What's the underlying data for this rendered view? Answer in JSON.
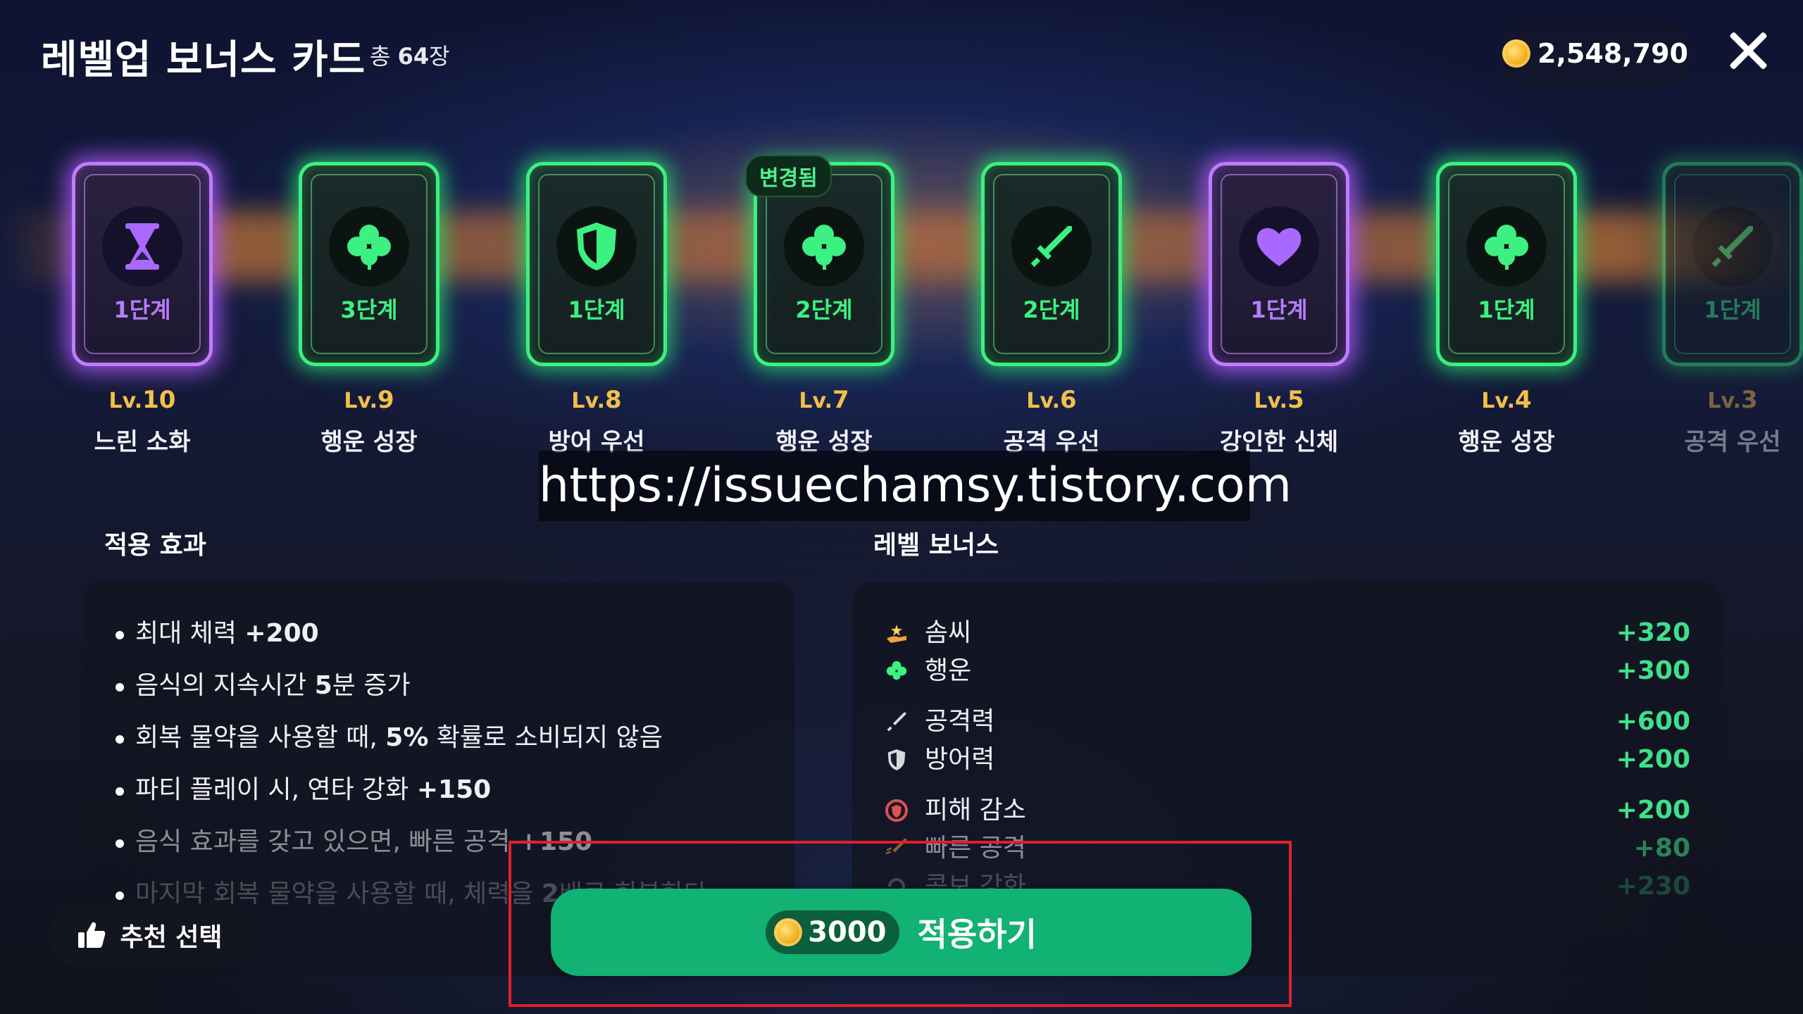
{
  "header": {
    "title": "레벨업 보너스 카드",
    "total_prefix": "총",
    "total_count": "64",
    "total_suffix": "장",
    "coins": "2,548,790"
  },
  "cards": [
    {
      "stage": "1단계",
      "lv_prefix": "Lv.",
      "lv": "10",
      "name": "느린 소화",
      "color": "purple",
      "icon": "hourglass-icon"
    },
    {
      "stage": "3단계",
      "lv_prefix": "Lv.",
      "lv": "9",
      "name": "행운 성장",
      "color": "green",
      "icon": "clover-icon"
    },
    {
      "stage": "1단계",
      "lv_prefix": "Lv.",
      "lv": "8",
      "name": "방어 우선",
      "color": "green",
      "icon": "shield-icon"
    },
    {
      "stage": "2단계",
      "lv_prefix": "Lv.",
      "lv": "7",
      "name": "행운 성장",
      "color": "green",
      "icon": "clover-icon",
      "badge": "변경됨"
    },
    {
      "stage": "2단계",
      "lv_prefix": "Lv.",
      "lv": "6",
      "name": "공격 우선",
      "color": "green",
      "icon": "sword-icon"
    },
    {
      "stage": "1단계",
      "lv_prefix": "Lv.",
      "lv": "5",
      "name": "강인한 신체",
      "color": "purple",
      "icon": "heart-icon"
    },
    {
      "stage": "1단계",
      "lv_prefix": "Lv.",
      "lv": "4",
      "name": "행운 성장",
      "color": "green",
      "icon": "clover-icon"
    },
    {
      "stage": "1단계",
      "lv_prefix": "Lv.",
      "lv": "3",
      "name": "공격 우선",
      "color": "green",
      "icon": "sword-icon"
    }
  ],
  "watermark": "https://issuechamsy.tistory.com",
  "effects": {
    "title": "적용 효과",
    "items": [
      {
        "text": "최대 체력 ",
        "bold": "+200",
        "rest": ""
      },
      {
        "text": "음식의 지속시간 ",
        "bold": "5",
        "rest": "분 증가"
      },
      {
        "text": "회복 물약을 사용할 때, ",
        "bold": "5%",
        "rest": " 확률로 소비되지 않음"
      },
      {
        "text": "파티 플레이 시, 연타 강화 ",
        "bold": "+150",
        "rest": ""
      },
      {
        "text": "음식 효과를 갖고 있으면, 빠른 공격 ",
        "bold": "+150",
        "rest": ""
      },
      {
        "text": "마지막 회복 물약을 사용할 때, 체력을 ",
        "bold": "2",
        "rest": "배로 회복한다"
      }
    ]
  },
  "level_bonus": {
    "title": "레벨 보너스",
    "items": [
      {
        "label": "솜씨",
        "value": "+320",
        "icon": "craft-hand-icon"
      },
      {
        "label": "행운",
        "value": "+300",
        "icon": "clover-icon"
      },
      {
        "label": "공격력",
        "value": "+600",
        "icon": "sword-icon"
      },
      {
        "label": "방어력",
        "value": "+200",
        "icon": "shield-icon"
      },
      {
        "label": "피해 감소",
        "value": "+200",
        "icon": "damage-reduce-icon"
      },
      {
        "label": "빠른 공격",
        "value": "+80",
        "icon": "fast-attack-icon"
      },
      {
        "label": "콤보 강화",
        "value": "+230",
        "icon": "combo-icon"
      }
    ]
  },
  "buttons": {
    "recommend": "추천 선택",
    "apply_price": "3000",
    "apply_label": "적용하기"
  },
  "colors": {
    "green_accent": "#3cf082",
    "purple_accent": "#b77bff",
    "apply_button": "#11b274",
    "level_gold": "#f2c04a",
    "highlight_box": "#e0202a"
  }
}
